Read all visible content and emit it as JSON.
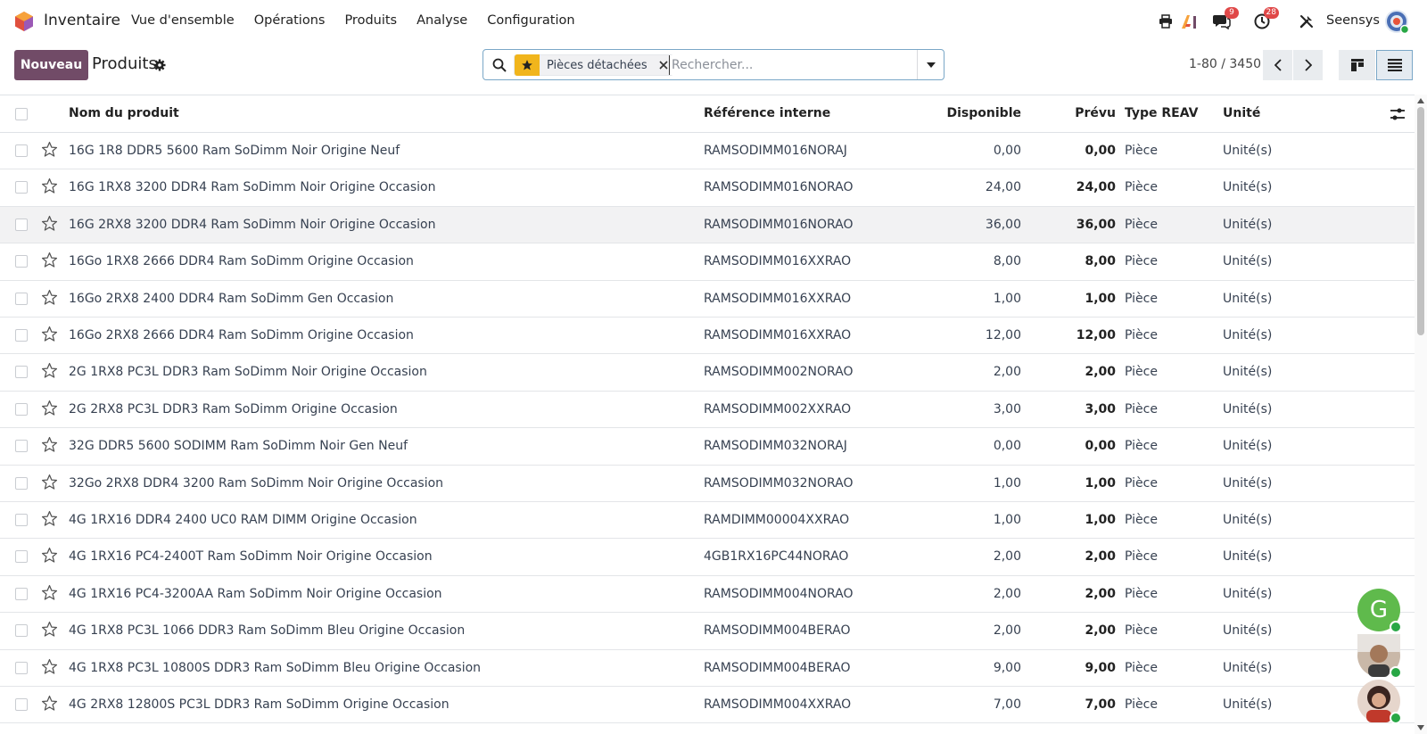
{
  "app": {
    "name": "Inventaire",
    "menu": [
      "Vue d'ensemble",
      "Opérations",
      "Produits",
      "Analyse",
      "Configuration"
    ],
    "messages_count": "9",
    "activities_count": "28",
    "company": "Seensys"
  },
  "control": {
    "new_label": "Nouveau",
    "title": "Produits",
    "facet_label": "Pièces détachées",
    "search_placeholder": "Rechercher...",
    "pager": "1-80 / 3450"
  },
  "table": {
    "headers": {
      "name": "Nom du produit",
      "ref": "Référence interne",
      "available": "Disponible",
      "forecast": "Prévu",
      "type": "Type REAV",
      "unit": "Unité"
    },
    "rows": [
      {
        "name": "16G 1R8 DDR5 5600 Ram SoDimm Noir Origine Neuf",
        "ref": "RAMSODIMM016NORAJ",
        "available": "0,00",
        "forecast": "0,00",
        "type": "Pièce",
        "unit": "Unité(s)"
      },
      {
        "name": "16G 1RX8 3200 DDR4 Ram SoDimm Noir Origine Occasion",
        "ref": "RAMSODIMM016NORAO",
        "available": "24,00",
        "forecast": "24,00",
        "type": "Pièce",
        "unit": "Unité(s)"
      },
      {
        "name": "16G 2RX8 3200 DDR4 Ram SoDimm Noir Origine Occasion",
        "ref": "RAMSODIMM016NORAO",
        "available": "36,00",
        "forecast": "36,00",
        "type": "Pièce",
        "unit": "Unité(s)"
      },
      {
        "name": "16Go 1RX8 2666 DDR4 Ram SoDimm Origine Occasion",
        "ref": "RAMSODIMM016XXRAO",
        "available": "8,00",
        "forecast": "8,00",
        "type": "Pièce",
        "unit": "Unité(s)"
      },
      {
        "name": "16Go 2RX8 2400 DDR4 Ram SoDimm Gen Occasion",
        "ref": "RAMSODIMM016XXRAO",
        "available": "1,00",
        "forecast": "1,00",
        "type": "Pièce",
        "unit": "Unité(s)"
      },
      {
        "name": "16Go 2RX8 2666 DDR4 Ram SoDimm Origine Occasion",
        "ref": "RAMSODIMM016XXRAO",
        "available": "12,00",
        "forecast": "12,00",
        "type": "Pièce",
        "unit": "Unité(s)"
      },
      {
        "name": "2G 1RX8 PC3L DDR3 Ram SoDimm Noir Origine Occasion",
        "ref": "RAMSODIMM002NORAO",
        "available": "2,00",
        "forecast": "2,00",
        "type": "Pièce",
        "unit": "Unité(s)"
      },
      {
        "name": "2G 2RX8 PC3L DDR3 Ram SoDimm Origine Occasion",
        "ref": "RAMSODIMM002XXRAO",
        "available": "3,00",
        "forecast": "3,00",
        "type": "Pièce",
        "unit": "Unité(s)"
      },
      {
        "name": "32G DDR5 5600 SODIMM Ram SoDimm Noir Gen Neuf",
        "ref": "RAMSODIMM032NORAJ",
        "available": "0,00",
        "forecast": "0,00",
        "type": "Pièce",
        "unit": "Unité(s)"
      },
      {
        "name": "32Go 2RX8 DDR4 3200 Ram SoDimm Noir Origine Occasion",
        "ref": "RAMSODIMM032NORAO",
        "available": "1,00",
        "forecast": "1,00",
        "type": "Pièce",
        "unit": "Unité(s)"
      },
      {
        "name": "4G 1RX16 DDR4 2400 UC0 RAM DIMM Origine Occasion",
        "ref": "RAMDIMM00004XXRAO",
        "available": "1,00",
        "forecast": "1,00",
        "type": "Pièce",
        "unit": "Unité(s)"
      },
      {
        "name": "4G 1RX16 PC4-2400T Ram SoDimm Noir Origine Occasion",
        "ref": "4GB1RX16PC44NORAO",
        "available": "2,00",
        "forecast": "2,00",
        "type": "Pièce",
        "unit": "Unité(s)"
      },
      {
        "name": "4G 1RX16 PC4-3200AA Ram SoDimm Noir Origine Occasion",
        "ref": "RAMSODIMM004NORAO",
        "available": "2,00",
        "forecast": "2,00",
        "type": "Pièce",
        "unit": "Unité(s)"
      },
      {
        "name": "4G 1RX8 PC3L 1066 DDR3 Ram SoDimm Bleu Origine Occasion",
        "ref": "RAMSODIMM004BERAO",
        "available": "2,00",
        "forecast": "2,00",
        "type": "Pièce",
        "unit": "Unité(s)"
      },
      {
        "name": "4G 1RX8 PC3L 10800S DDR3 Ram SoDimm Bleu Origine Occasion",
        "ref": "RAMSODIMM004BERAO",
        "available": "9,00",
        "forecast": "9,00",
        "type": "Pièce",
        "unit": "Unité(s)"
      },
      {
        "name": "4G 2RX8 12800S PC3L DDR3 Ram SoDimm Origine Occasion",
        "ref": "RAMSODIMM004XXRAO",
        "available": "7,00",
        "forecast": "7,00",
        "type": "Pièce",
        "unit": "Unité(s)"
      }
    ]
  },
  "chat": {
    "initial": "G"
  },
  "colors": {
    "brand": "#714b67",
    "facet_star": "#f1b51c",
    "badge": "#e04848",
    "online": "#28a745"
  }
}
